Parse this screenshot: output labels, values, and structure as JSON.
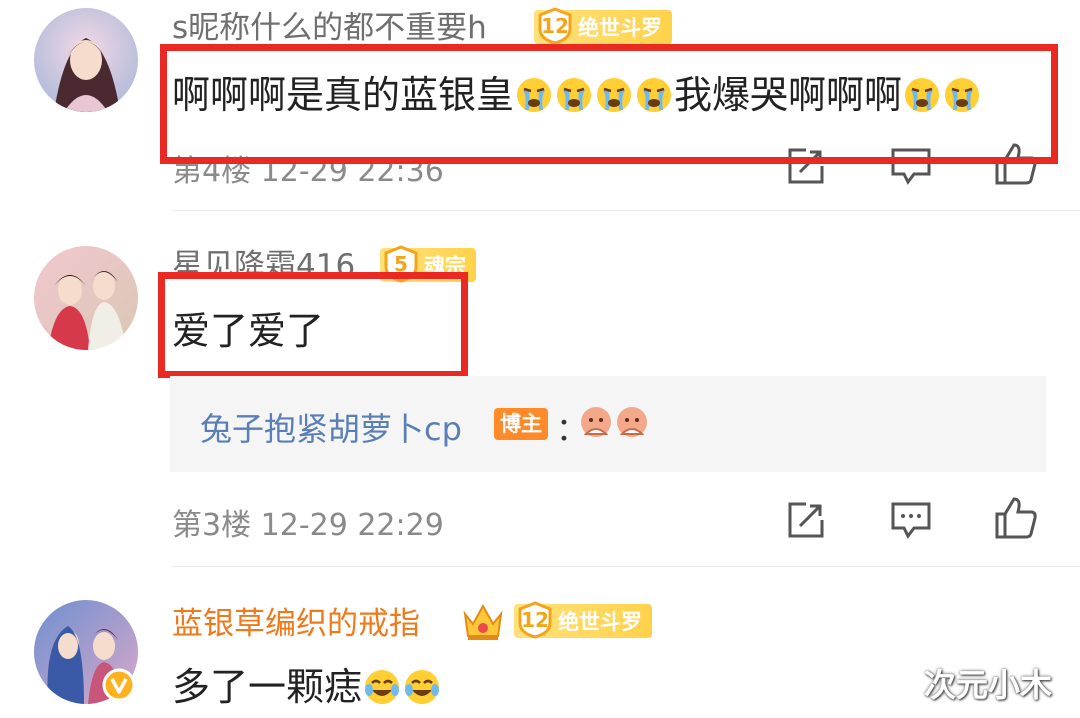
{
  "comments": [
    {
      "username": "s昵称什么的都不重要h",
      "badge_level": "12",
      "badge_title": "绝世斗罗",
      "text_parts": [
        "啊啊啊是真的蓝银皇",
        "我爆哭啊啊啊"
      ],
      "emoji": "crying-face",
      "floor": "第4楼",
      "time": "12-29 22:36"
    },
    {
      "username": "星见降霜416",
      "badge_level": "5",
      "badge_title": "魂宗",
      "text": "爱了爱了",
      "reply_user": "兔子抱紧胡萝卜cp",
      "reply_tag": "博主",
      "reply_sep": "：",
      "reply_emoji": "hand-clasp-face",
      "floor": "第3楼",
      "time": "12-29 22:29"
    },
    {
      "username": "蓝银草编织的戒指",
      "badge_level": "12",
      "badge_title": "绝世斗罗",
      "text": "多了一颗痣",
      "emoji": "laughing-crying-face",
      "verified": true
    }
  ],
  "watermark": "次元小木",
  "colors": {
    "highlight_box": "#ea2a22",
    "username_gray": "#6f6f6f",
    "username_orange": "#ef7a1a",
    "reply_blue": "#5a7fb6",
    "host_tag": "#ff8a2a",
    "badge_gold": "#ffd24a"
  }
}
